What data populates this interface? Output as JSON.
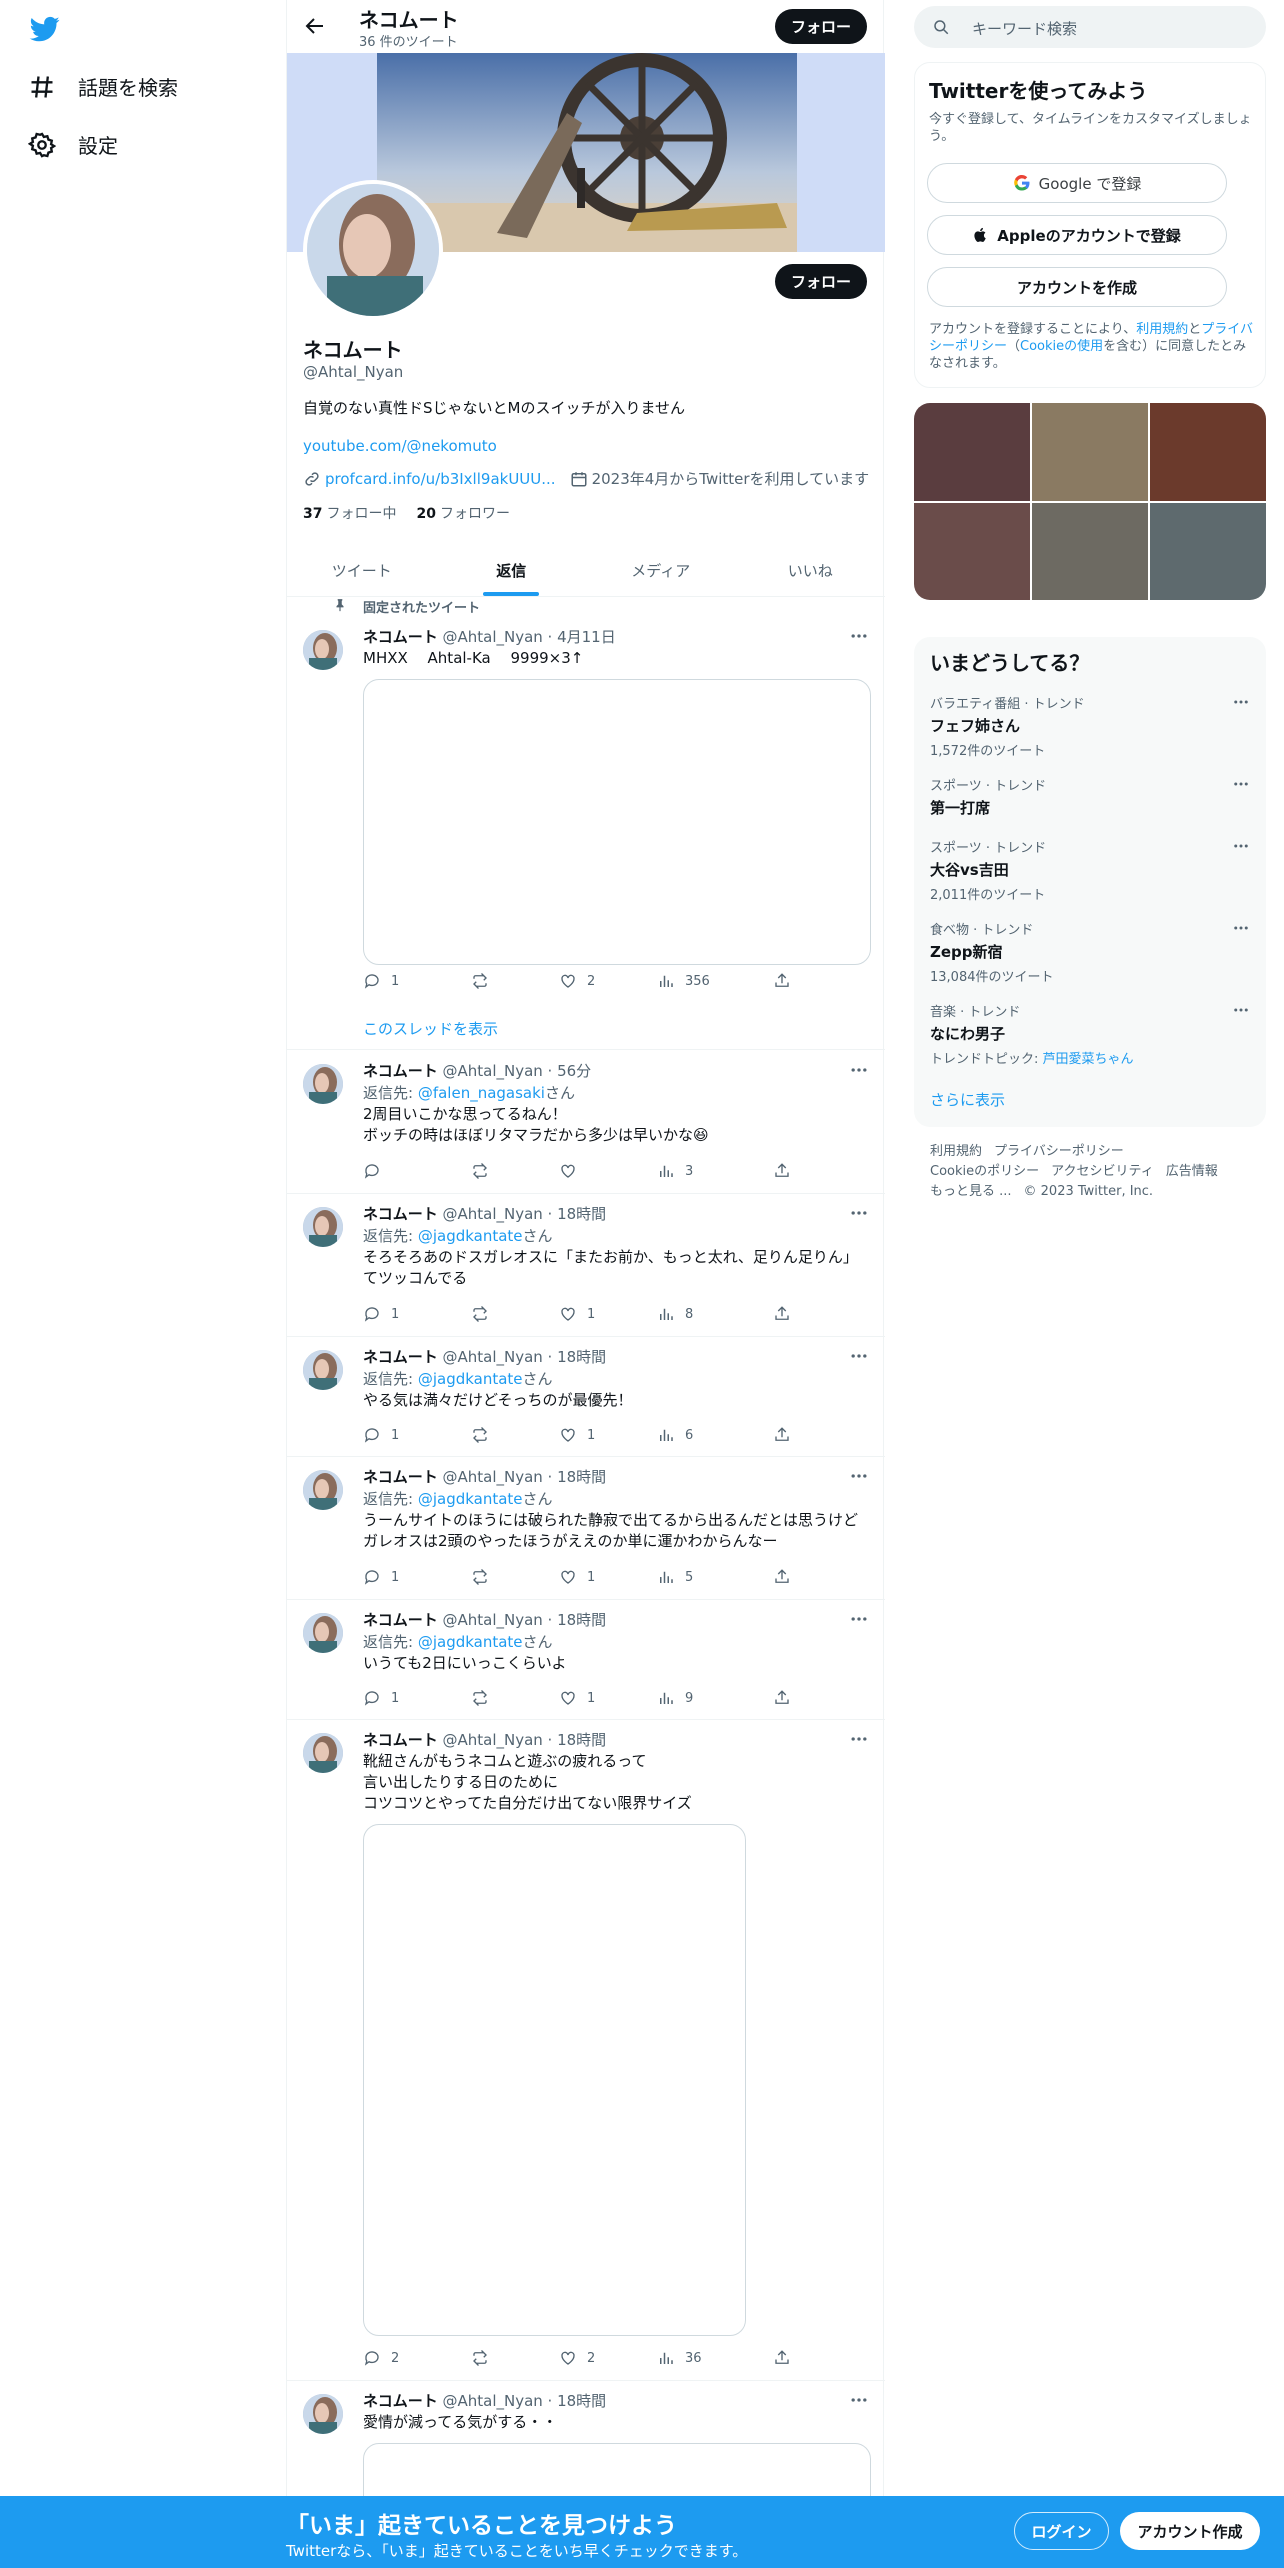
{
  "nav": {
    "items": [
      {
        "label": "話題を検索",
        "icon": "hashtag-icon"
      },
      {
        "label": "設定",
        "icon": "gear-icon"
      }
    ]
  },
  "header": {
    "title": "ネコムート",
    "tweet_count": "36 件のツイート",
    "follow_label": "フォロー"
  },
  "profile": {
    "name": "ネコムート",
    "handle": "@Ahtal_Nyan",
    "bio": "自覚のない真性ドSじゃないとMのスイッチが入りません",
    "link": "youtube.com/@nekomuto",
    "url": "profcard.info/u/b3Ixll9akUUU...",
    "joined": "2023年4月からTwitterを利用しています",
    "following_count": "37",
    "following_label": "フォロー中",
    "followers_count": "20",
    "followers_label": "フォロワー",
    "follow_label": "フォロー"
  },
  "tabs": [
    {
      "label": "ツイート",
      "active": false
    },
    {
      "label": "返信",
      "active": true
    },
    {
      "label": "メディア",
      "active": false
    },
    {
      "label": "いいね",
      "active": false
    }
  ],
  "pinned_label": "固定されたツイート",
  "show_thread": "このスレッドを表示",
  "tweets": [
    {
      "name": "ネコムート",
      "meta": "@Ahtal_Nyan · 4月11日",
      "reply_prefix": "",
      "reply_to": "",
      "reply_suffix": "",
      "text": "MHXX　 Ahtal-Ka　 9999×3↑",
      "replies": "1",
      "retweets": "",
      "likes": "2",
      "views": "356"
    },
    {
      "name": "ネコムート",
      "meta": "@Ahtal_Nyan · 56分",
      "reply_prefix": "返信先: ",
      "reply_to": "@falen_nagasaki",
      "reply_suffix": "さん",
      "text": "2周目いこかな思ってるねん！\nボッチの時はほぼリタマラだから多少は早いかな😆",
      "replies": "",
      "retweets": "",
      "likes": "",
      "views": "3"
    },
    {
      "name": "ネコムート",
      "meta": "@Ahtal_Nyan · 18時間",
      "reply_prefix": "返信先: ",
      "reply_to": "@jagdkantate",
      "reply_suffix": "さん",
      "text": "そろそろあのドスガレオスに「またお前か、もっと太れ、足りん足りん」\nてツッコんでる",
      "replies": "1",
      "retweets": "",
      "likes": "1",
      "views": "8"
    },
    {
      "name": "ネコムート",
      "meta": "@Ahtal_Nyan · 18時間",
      "reply_prefix": "返信先: ",
      "reply_to": "@jagdkantate",
      "reply_suffix": "さん",
      "text": "やる気は満々だけどそっちのが最優先！",
      "replies": "1",
      "retweets": "",
      "likes": "1",
      "views": "6"
    },
    {
      "name": "ネコムート",
      "meta": "@Ahtal_Nyan · 18時間",
      "reply_prefix": "返信先: ",
      "reply_to": "@jagdkantate",
      "reply_suffix": "さん",
      "text": "うーんサイトのほうには破られた静寂で出てるから出るんだとは思うけど\nガレオスは2頭のやったほうがええのか単に運かわからんなー",
      "replies": "1",
      "retweets": "",
      "likes": "1",
      "views": "5"
    },
    {
      "name": "ネコムート",
      "meta": "@Ahtal_Nyan · 18時間",
      "reply_prefix": "返信先: ",
      "reply_to": "@jagdkantate",
      "reply_suffix": "さん",
      "text": "いうても2日にいっこくらいよ",
      "replies": "1",
      "retweets": "",
      "likes": "1",
      "views": "9"
    },
    {
      "name": "ネコムート",
      "meta": "@Ahtal_Nyan · 18時間",
      "reply_prefix": "",
      "reply_to": "",
      "reply_suffix": "",
      "text": "靴紐さんがもうネコムと遊ぶの疲れるって\n言い出したりする日のために\nコツコツとやってた自分だけ出てない限界サイズ",
      "replies": "2",
      "retweets": "",
      "likes": "2",
      "views": "36"
    },
    {
      "name": "ネコムート",
      "meta": "@Ahtal_Nyan · 18時間",
      "reply_prefix": "",
      "reply_to": "",
      "reply_suffix": "",
      "text": "愛情が減ってる気がする・・",
      "replies": "",
      "retweets": "",
      "likes": "",
      "views": ""
    }
  ],
  "search": {
    "placeholder": "キーワード検索"
  },
  "signup": {
    "title": "Twitterを使ってみよう",
    "subtitle": "今すぐ登録して、タイムラインをカスタマイズしましょう。",
    "google": "Google で登録",
    "apple": "Appleのアカウントで登録",
    "create": "アカウントを作成",
    "legal_prefix": "アカウントを登録することにより、",
    "legal_terms": "利用規約",
    "legal_and": "と",
    "legal_privacy": "プライバシーポリシー",
    "legal_cookie_open": "（",
    "legal_cookie": "Cookieの使用",
    "legal_suffix": "を含む）に同意したとみなされます。"
  },
  "trends": {
    "title": "いまどうしてる？",
    "items": [
      {
        "category": "バラエティ番組 · トレンド",
        "term": "フェフ姉さん",
        "count": "1,572件のツイート"
      },
      {
        "category": "スポーツ · トレンド",
        "term": "第一打席",
        "count": ""
      },
      {
        "category": "スポーツ · トレンド",
        "term": "大谷vs吉田",
        "count": "2,011件のツイート"
      },
      {
        "category": "食べ物 · トレンド",
        "term": "Zepp新宿",
        "count": "13,084件のツイート"
      },
      {
        "category": "音楽 · トレンド",
        "term": "なにわ男子",
        "count_prefix": "トレンドトピック: ",
        "count_link": "芦田愛菜ちゃん"
      }
    ],
    "show_more": "さらに表示"
  },
  "footer": {
    "links": [
      "利用規約",
      "プライバシーポリシー",
      "Cookieのポリシー",
      "アクセシビリティ",
      "広告情報",
      "もっと見る ..."
    ],
    "copyright": "© 2023 Twitter, Inc."
  },
  "bottombar": {
    "title": "「いま」起きていることを見つけよう",
    "subtitle": "Twitterなら、「いま」起きていることをいち早くチェックできます。",
    "login": "ログイン",
    "signup": "アカウント作成"
  },
  "colors": {
    "accent": "#1d9bf0",
    "text": "#0f1419",
    "muted": "#536471",
    "border": "#eff3f4"
  }
}
